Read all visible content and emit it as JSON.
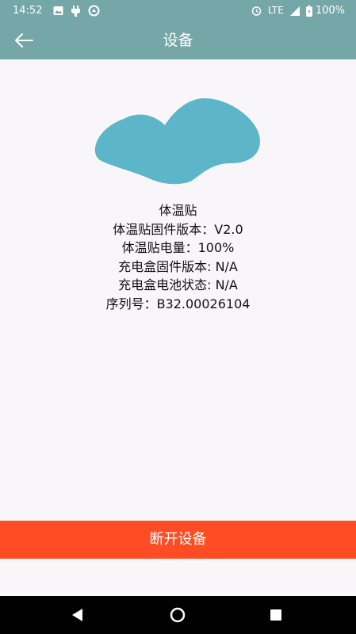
{
  "status_bar": {
    "time": "14:52",
    "network": "LTE",
    "battery": "100%",
    "icons": [
      "image-icon",
      "usb-icon",
      "sync-icon",
      "alarm-icon",
      "signal-icon",
      "battery-icon"
    ]
  },
  "app_bar": {
    "title": "设备",
    "back_icon": "arrow-left-icon"
  },
  "device": {
    "logo_color": "#5cb5c9",
    "name": "体温贴",
    "firmware": "体温贴固件版本：V2.0",
    "battery": "体温贴电量：100%",
    "case_firmware": "充电盒固件版本: N/A",
    "case_battery": "充电盒电池状态: N/A",
    "serial": "序列号：B32.00026104"
  },
  "actions": {
    "disconnect_label": "断开设备",
    "disconnect_color": "#fe4d24"
  },
  "colors": {
    "toolbar": "#75a6a8",
    "background": "#f8f6f9"
  },
  "nav_bar": {
    "icons": [
      "back-triangle-icon",
      "home-circle-icon",
      "recents-square-icon"
    ]
  }
}
